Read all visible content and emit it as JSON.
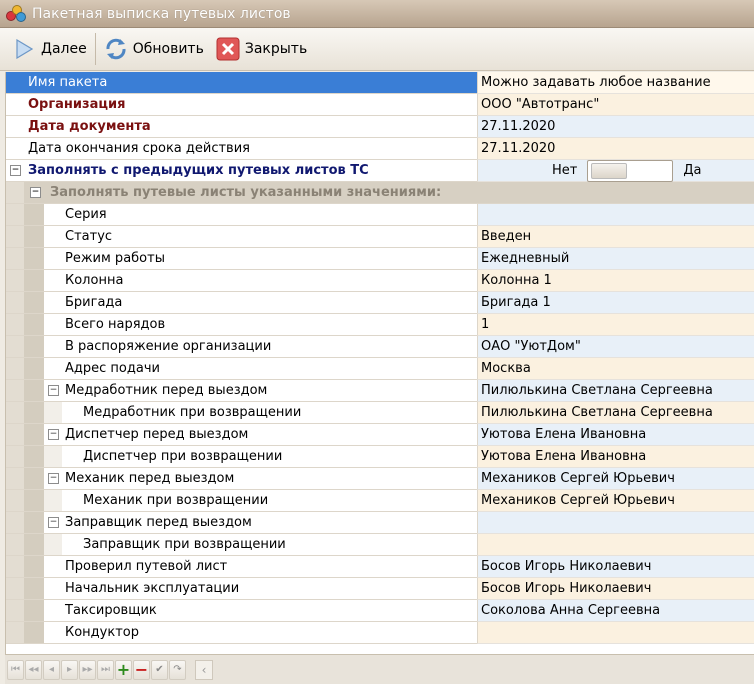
{
  "window": {
    "title": "Пакетная выписка путевых листов"
  },
  "toolbar": {
    "next_label": "Далее",
    "refresh_label": "Обновить",
    "close_label": "Закрыть"
  },
  "colors": {
    "selection": "#3a7ed6",
    "bold_red": "#7a1010",
    "bold_navy": "#101870",
    "add_green": "#2c8a1c",
    "delete_red": "#c81c1c"
  },
  "rows": [
    {
      "name": "Имя пакета",
      "value": "Можно задавать любое название"
    },
    {
      "name": "Организация",
      "value": "ООО \"Автотранс\""
    },
    {
      "name": "Дата документа",
      "value": "27.11.2020"
    },
    {
      "name": "Дата окончания срока действия",
      "value": "27.11.2020"
    }
  ],
  "fill_from_previous": {
    "name": "Заполнять с предыдущих путевых листов ТС",
    "no": "Нет",
    "yes": "Да",
    "state": "Нет"
  },
  "fill_group": {
    "title": "Заполнять путевые листы указанными значениями:",
    "items": [
      {
        "name": "Серия",
        "value": ""
      },
      {
        "name": "Статус",
        "value": "Введен"
      },
      {
        "name": "Режим работы",
        "value": "Ежедневный"
      },
      {
        "name": "Колонна",
        "value": "Колонна 1"
      },
      {
        "name": "Бригада",
        "value": "Бригада 1"
      },
      {
        "name": "Всего нарядов",
        "value": "1"
      },
      {
        "name": "В распоряжение организации",
        "value": "ОАО \"УютДом\""
      },
      {
        "name": "Адрес подачи",
        "value": "Москва"
      },
      {
        "name": "Медработник перед выездом",
        "value": "Пилюлькина Светлана Сергеевна"
      },
      {
        "name": "Медработник при возвращении",
        "value": "Пилюлькина Светлана Сергеевна"
      },
      {
        "name": "Диспетчер перед выездом",
        "value": "Уютова Елена Ивановна"
      },
      {
        "name": "Диспетчер при возвращении",
        "value": "Уютова Елена Ивановна"
      },
      {
        "name": "Механик перед выездом",
        "value": "Механиков Сергей Юрьевич"
      },
      {
        "name": "Механик при возвращении",
        "value": "Механиков Сергей Юрьевич"
      },
      {
        "name": "Заправщик перед выездом",
        "value": ""
      },
      {
        "name": "Заправщик при возвращении",
        "value": ""
      },
      {
        "name": "Проверил путевой лист",
        "value": "Босов Игорь Николаевич"
      },
      {
        "name": "Начальник эксплуатации",
        "value": "Босов Игорь Николаевич"
      },
      {
        "name": "Таксировщик",
        "value": "Соколова Анна Сергеевна"
      },
      {
        "name": "Кондуктор",
        "value": ""
      }
    ]
  },
  "navigator": {
    "icons": [
      "first-icon",
      "prev-page-icon",
      "prev-icon",
      "next-icon",
      "next-page-icon",
      "last-icon",
      "add-icon",
      "delete-icon",
      "post-icon",
      "cancel-icon"
    ]
  }
}
